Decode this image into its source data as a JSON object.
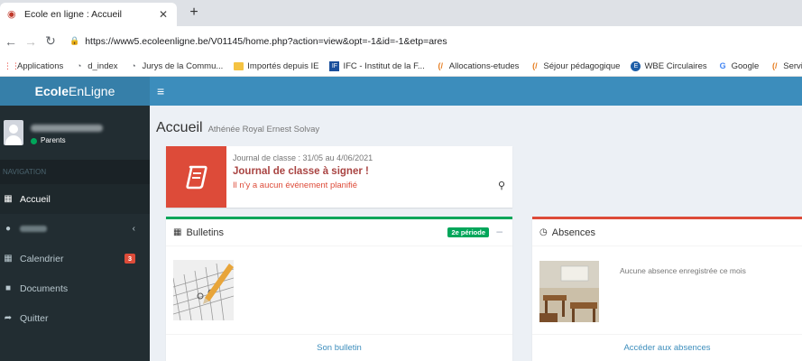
{
  "browser": {
    "tab_title": "Ecole en ligne : Accueil",
    "url": "https://www5.ecoleenligne.be/V01145/home.php?action=view&opt=-1&id=-1&etp=ares",
    "bookmarks": [
      {
        "label": "Applications",
        "icon": "apps-icon",
        "color": "#e8453c"
      },
      {
        "label": "d_index",
        "icon": "globe-icon",
        "color": "#5f6368"
      },
      {
        "label": "Jurys de la Commu...",
        "icon": "globe-icon",
        "color": "#5f6368"
      },
      {
        "label": "Importés depuis IE",
        "icon": "folder-icon",
        "color": "#f5c342"
      },
      {
        "label": "IFC - Institut de la F...",
        "icon": "ifc-icon",
        "color": "#1a4f9c"
      },
      {
        "label": "Allocations-etudes",
        "icon": "fwb-icon",
        "color": "#e67e22"
      },
      {
        "label": "Séjour pédagogique",
        "icon": "fwb-icon",
        "color": "#e67e22"
      },
      {
        "label": "WBE Circulaires",
        "icon": "wbe-icon",
        "color": "#1f5fa8"
      },
      {
        "label": "Google",
        "icon": "google-icon",
        "color": "#4285f4"
      },
      {
        "label": "Service so",
        "icon": "fwb-icon",
        "color": "#e67e22"
      }
    ]
  },
  "app": {
    "logo_bold": "Ecole",
    "logo_rest": "EnLigne"
  },
  "sidebar": {
    "user_role": "Parents",
    "nav_header": "NAVIGATION",
    "items": [
      {
        "label": "Accueil",
        "icon": "grid-icon"
      },
      {
        "label": "",
        "icon": "user-icon"
      },
      {
        "label": "Calendrier",
        "icon": "calendar-icon",
        "badge": "3"
      },
      {
        "label": "Documents",
        "icon": "folder-icon"
      },
      {
        "label": "Quitter",
        "icon": "share-icon"
      }
    ]
  },
  "main": {
    "title": "Accueil",
    "subtitle": "Athénée Royal Ernest Solvay",
    "journal": {
      "date_label": "Journal de classe : 31/05 au 4/06/2021",
      "title": "Journal de classe à signer !",
      "message": "Il n'y a aucun événement planifié"
    },
    "bulletins": {
      "title": "Bulletins",
      "period": "2e période",
      "link": "Son bulletin"
    },
    "absences": {
      "title": "Absences",
      "message": "Aucune absence enregistrée ce mois",
      "link": "Accéder aux absences"
    }
  },
  "colors": {
    "brand_dark": "#367fa9",
    "brand": "#3c8dbc",
    "sidebar": "#222d32",
    "success": "#00a65a",
    "danger": "#dd4b39"
  }
}
